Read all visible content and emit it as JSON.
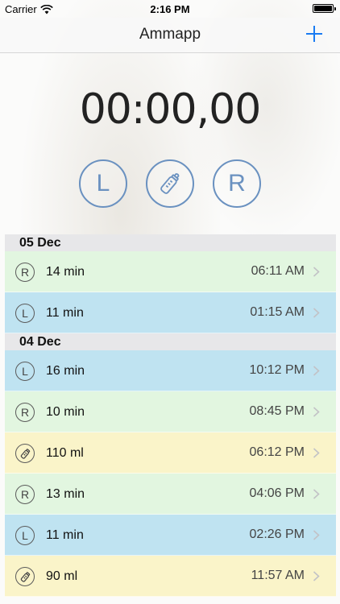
{
  "status_bar": {
    "carrier": "Carrier",
    "time": "2:16 PM"
  },
  "nav": {
    "title": "Ammapp",
    "add_icon": "plus-icon"
  },
  "timer": {
    "minutes": "00",
    "sep1": ":",
    "seconds": "00",
    "sep2": ",",
    "hundredths": "00"
  },
  "mode_buttons": {
    "left_label": "L",
    "right_label": "R",
    "bottle_icon": "baby-bottle-icon"
  },
  "colors": {
    "accent": "#1a7bf2",
    "mode_ring": "#6a91c0",
    "right_row": "#e2f6e0",
    "left_row": "#bfe3f1",
    "bottle_row": "#faf4c9",
    "day_header": "#e7e7e9"
  },
  "days": [
    {
      "label": "05 Dec",
      "entries": [
        {
          "type": "R",
          "amount": "14 min",
          "time": "06:11 AM"
        },
        {
          "type": "L",
          "amount": "11 min",
          "time": "01:15 AM"
        }
      ]
    },
    {
      "label": "04 Dec",
      "entries": [
        {
          "type": "L",
          "amount": "16 min",
          "time": "10:12 PM"
        },
        {
          "type": "R",
          "amount": "10 min",
          "time": "08:45 PM"
        },
        {
          "type": "bottle",
          "amount": "110 ml",
          "time": "06:12 PM"
        },
        {
          "type": "R",
          "amount": "13 min",
          "time": "04:06 PM"
        },
        {
          "type": "L",
          "amount": "11 min",
          "time": "02:26 PM"
        },
        {
          "type": "bottle",
          "amount": "90 ml",
          "time": "11:57 AM"
        }
      ]
    }
  ]
}
